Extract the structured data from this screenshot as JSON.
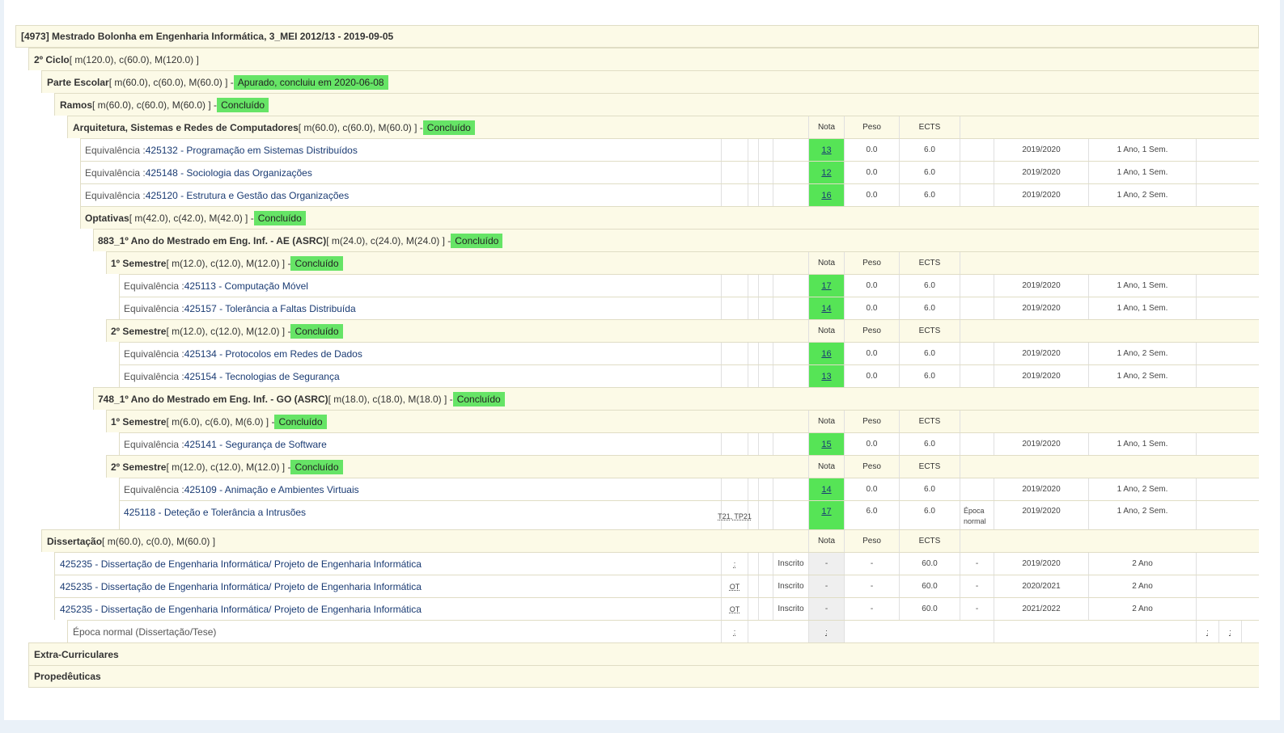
{
  "header": {
    "title": "[4973] Mestrado Bolonha em Engenharia Informática, 3_MEI 2012/13 - 2019-09-05"
  },
  "labels": {
    "equiv": "Equivalência : ",
    "nota": "Nota",
    "peso": "Peso",
    "ects": "ECTS",
    "dash": "-",
    "dot": ":"
  },
  "groups": {
    "ciclo": {
      "name": "2º Ciclo",
      "credits": " [ m(120.0), c(60.0), M(120.0) ]"
    },
    "parte": {
      "name": "Parte Escolar",
      "credits": " [ m(60.0), c(60.0), M(60.0) ] - ",
      "status": "Apurado, concluiu em 2020-06-08"
    },
    "ramos": {
      "name": "Ramos",
      "credits": " [ m(60.0), c(60.0), M(60.0) ] - ",
      "status": "Concluído"
    },
    "asrc": {
      "name": "Arquitetura, Sistemas e Redes de Computadores",
      "credits": " [ m(60.0), c(60.0), M(60.0) ] - ",
      "status": "Concluído"
    },
    "optativas": {
      "name": "Optativas",
      "credits": " [ m(42.0), c(42.0), M(42.0) ] - ",
      "status": "Concluído"
    },
    "g883": {
      "name": "883_1º Ano do Mestrado em Eng. Inf. - AE (ASRC)",
      "credits": " [ m(24.0), c(24.0), M(24.0) ] - ",
      "status": "Concluído"
    },
    "g883s1": {
      "name": "1º Semestre",
      "credits": " [ m(12.0), c(12.0), M(12.0) ] - ",
      "status": "Concluído"
    },
    "g883s2": {
      "name": "2º Semestre",
      "credits": " [ m(12.0), c(12.0), M(12.0) ] - ",
      "status": "Concluído"
    },
    "g748": {
      "name": "748_1º Ano do Mestrado em Eng. Inf. - GO (ASRC)",
      "credits": " [ m(18.0), c(18.0), M(18.0) ] - ",
      "status": "Concluído"
    },
    "g748s1": {
      "name": "1º Semestre",
      "credits": " [ m(6.0), c(6.0), M(6.0) ] - ",
      "status": "Concluído"
    },
    "g748s2": {
      "name": "2º Semestre",
      "credits": " [ m(12.0), c(12.0), M(12.0) ] - ",
      "status": "Concluído"
    },
    "diss": {
      "name": "Dissertação",
      "credits": " [ m(60.0), c(0.0), M(60.0) ]"
    },
    "extra": {
      "name": "Extra-Curriculares"
    },
    "prop": {
      "name": "Propedêuticas"
    }
  },
  "courses": [
    {
      "code": "425132 - Programação em Sistemas Distribuídos",
      "grade": "13",
      "peso": "0.0",
      "ects": "6.0",
      "year": "2019/2020",
      "sem": "1 Ano, 1 Sem."
    },
    {
      "code": "425148 - Sociologia das Organizações",
      "grade": "12",
      "peso": "0.0",
      "ects": "6.0",
      "year": "2019/2020",
      "sem": "1 Ano, 1 Sem."
    },
    {
      "code": "425120 - Estrutura e Gestão das Organizações",
      "grade": "16",
      "peso": "0.0",
      "ects": "6.0",
      "year": "2019/2020",
      "sem": "1 Ano, 2 Sem."
    },
    {
      "code": "425113 - Computação Móvel",
      "grade": "17",
      "peso": "0.0",
      "ects": "6.0",
      "year": "2019/2020",
      "sem": "1 Ano, 1 Sem."
    },
    {
      "code": "425157 - Tolerância a Faltas Distribuída",
      "grade": "14",
      "peso": "0.0",
      "ects": "6.0",
      "year": "2019/2020",
      "sem": "1 Ano, 1 Sem."
    },
    {
      "code": "425134 - Protocolos em Redes de Dados",
      "grade": "16",
      "peso": "0.0",
      "ects": "6.0",
      "year": "2019/2020",
      "sem": "1 Ano, 2 Sem."
    },
    {
      "code": "425154 - Tecnologias de Segurança",
      "grade": "13",
      "peso": "0.0",
      "ects": "6.0",
      "year": "2019/2020",
      "sem": "1 Ano, 2 Sem."
    },
    {
      "code": "425141 - Segurança de Software",
      "grade": "15",
      "peso": "0.0",
      "ects": "6.0",
      "year": "2019/2020",
      "sem": "1 Ano, 1 Sem."
    },
    {
      "code": "425109 - Animação e Ambientes Virtuais",
      "grade": "14",
      "peso": "0.0",
      "ects": "6.0",
      "year": "2019/2020",
      "sem": "1 Ano, 2 Sem."
    },
    {
      "code": "425118 - Deteção e Tolerância a Intrusões",
      "turmas": "T21, TP21",
      "grade": "17",
      "peso": "6.0",
      "ects": "6.0",
      "epoca": "Época normal",
      "year": "2019/2020",
      "sem": "1 Ano, 2 Sem."
    }
  ],
  "dissertation": [
    {
      "code": "425235 - Dissertação de Engenharia Informática/ Projeto de Engenharia Informática",
      "turma": ":",
      "state": "Inscrito",
      "grade": "-",
      "peso": "-",
      "ects": "60.0",
      "epoca": "-",
      "year": "2019/2020",
      "sem": "2 Ano"
    },
    {
      "code": "425235 - Dissertação de Engenharia Informática/ Projeto de Engenharia Informática",
      "turma": "OT",
      "state": "Inscrito",
      "grade": "-",
      "peso": "-",
      "ects": "60.0",
      "epoca": "-",
      "year": "2020/2021",
      "sem": "2 Ano"
    },
    {
      "code": "425235 - Dissertação de Engenharia Informática/ Projeto de Engenharia Informática",
      "turma": "OT",
      "state": "Inscrito",
      "grade": "-",
      "peso": "-",
      "ects": "60.0",
      "epoca": "-",
      "year": "2021/2022",
      "sem": "2 Ano"
    }
  ],
  "epoca_row": {
    "label": "Época normal (Dissertação/Tese)",
    "turma": ":",
    "grade": ":"
  },
  "colors": {
    "badge": "#66e466",
    "grade": "#56e456",
    "header_bg": "#fcfae7",
    "link": "#1a3b73"
  }
}
